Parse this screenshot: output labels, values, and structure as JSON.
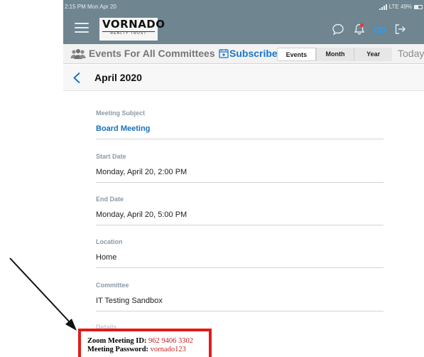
{
  "status_bar": {
    "time_date": "2:15 PM  Mon Apr 20",
    "network": "LTE 49%"
  },
  "nav_bar": {
    "logo_text": "VORNADO",
    "logo_subtext": "REALTY TRUST",
    "icons": [
      "menu-icon",
      "chat-icon",
      "bell-icon",
      "link-icon",
      "logout-icon"
    ],
    "background_color": "#6f8590",
    "notification_dot_color": "#e53935",
    "link_icon_color": "#2b9cf0"
  },
  "toolbar": {
    "title": "Events For All Committees",
    "subscribe_label": "Subscribe",
    "segments": [
      "Events",
      "Month",
      "Year"
    ],
    "selected_segment": "Events",
    "today_label": "Today",
    "accent_color": "#1a77c9"
  },
  "header": {
    "month_title": "April 2020"
  },
  "event": {
    "meeting_subject_label": "Meeting Subject",
    "meeting_subject_value": "Board Meeting",
    "start_date_label": "Start Date",
    "start_date_value": "Monday, April 20, 2:00 PM",
    "end_date_label": "End Date",
    "end_date_value": "Monday, April 20, 5:00 PM",
    "location_label": "Location",
    "location_value": "Home",
    "committee_label": "Committee",
    "committee_value": "IT Testing Sandbox",
    "details_label": "Details",
    "zoom_id_label": "Zoom Meeting ID:",
    "zoom_id_value": "962 9406 3302",
    "password_label": "Meeting Password:",
    "password_value": "vornado123"
  },
  "annotation": {
    "highlight_color": "#e21b1b",
    "arrow_color": "#111111"
  }
}
